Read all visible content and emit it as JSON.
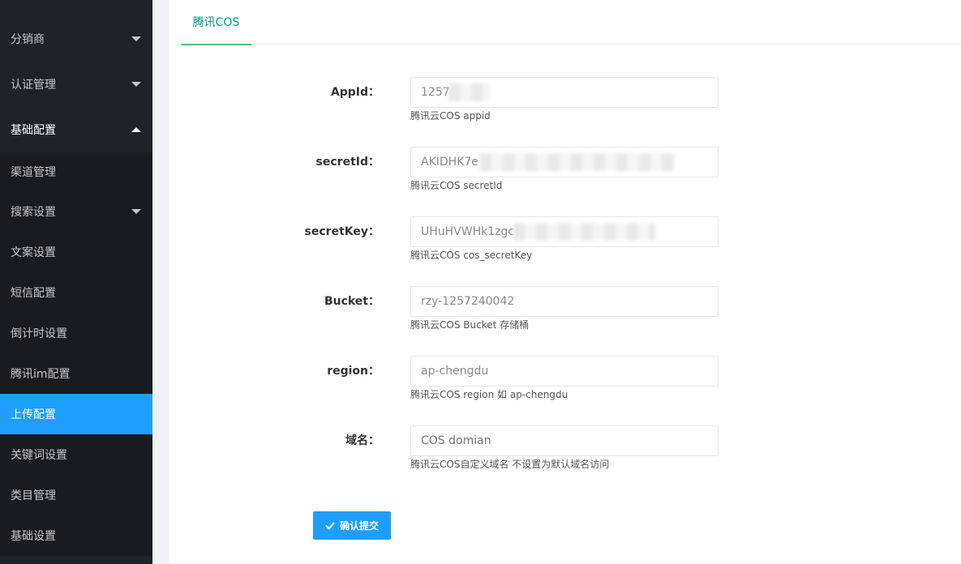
{
  "sidebar": {
    "groups": [
      {
        "label": "分销商"
      },
      {
        "label": "认证管理"
      },
      {
        "label": "基础配置"
      }
    ],
    "items": [
      {
        "label": "渠道管理"
      },
      {
        "label": "搜索设置"
      },
      {
        "label": "文案设置"
      },
      {
        "label": "短信配置"
      },
      {
        "label": "倒计时设置"
      },
      {
        "label": "腾讯im配置"
      },
      {
        "label": "上传配置"
      },
      {
        "label": "关键词设置"
      },
      {
        "label": "类目管理"
      },
      {
        "label": "基础设置"
      }
    ]
  },
  "tabs": [
    {
      "label": "腾讯COS"
    }
  ],
  "form": {
    "fields": [
      {
        "label": "AppId：",
        "value": "1257",
        "tip": "腾讯云COS appid"
      },
      {
        "label": "secretId：",
        "value": "AKIDHK7e",
        "tip": "腾讯云COS secretId"
      },
      {
        "label": "secretKey：",
        "value": "UHuHVWHk1zgc",
        "tip": "腾讯云COS cos_secretKey"
      },
      {
        "label": "Bucket：",
        "value": "rzy-1257240042",
        "tip": "腾讯云COS Bucket 存储桶"
      },
      {
        "label": "region：",
        "value": "ap-chengdu",
        "tip": "腾讯云COS region 如 ap-chengdu"
      },
      {
        "label": "域名：",
        "value": "",
        "placeholder": "COS domian",
        "tip": "腾讯云COS自定义域名 不设置为默认域名访问"
      }
    ],
    "submit_label": "确认提交"
  },
  "colors": {
    "sidebar_bg": "#20222a",
    "active_item": "#1e9fff",
    "tab_text": "#009688",
    "button": "#1e9fff"
  }
}
